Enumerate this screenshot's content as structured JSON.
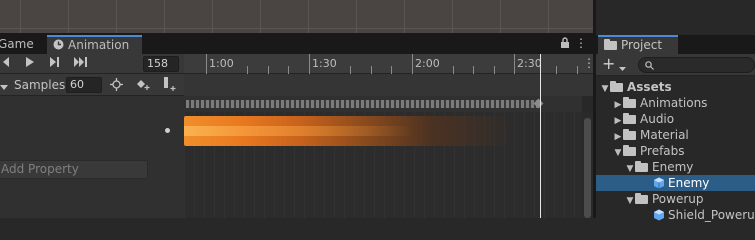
{
  "tabs": {
    "game": "Game",
    "animation": "Animation",
    "animation_icon": "clock-icon"
  },
  "animation": {
    "frame": "158",
    "samples_label": "Samples",
    "samples_value": "60",
    "add_property": "Add Property",
    "timeline_labels": [
      "1:00",
      "1:30",
      "2:00",
      "2:30"
    ]
  },
  "project": {
    "tab_label": "Project",
    "add_symbol": "+",
    "tree": {
      "assets": "Assets",
      "animations": "Animations",
      "audio": "Audio",
      "material": "Material",
      "prefabs": "Prefabs",
      "enemy_folder": "Enemy",
      "enemy_prefab": "Enemy",
      "powerup": "Powerup",
      "shield_powerup": "Shield_Powerup"
    }
  },
  "colors": {
    "accent": "#4a8ad6",
    "selection": "#2c5d87",
    "flame": "#f08f2a"
  }
}
